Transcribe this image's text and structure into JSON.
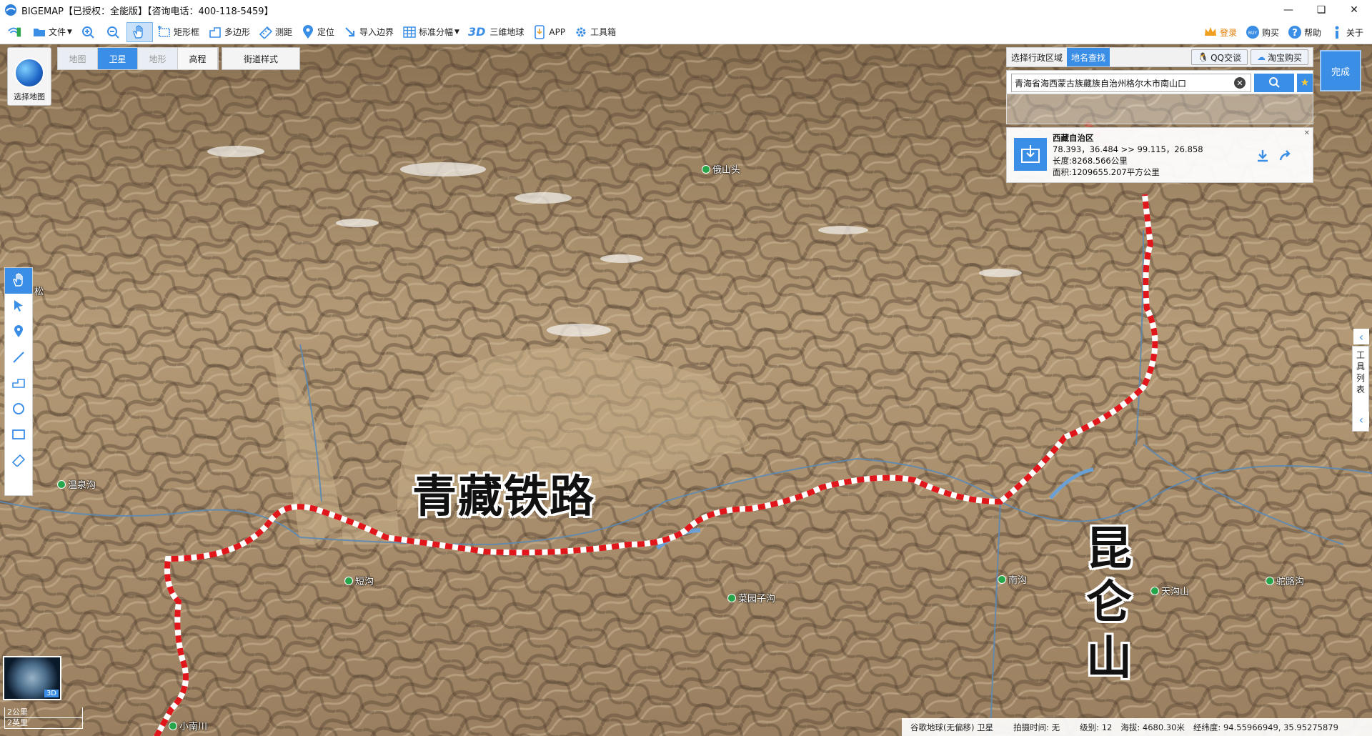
{
  "window": {
    "title": "BIGEMAP【已授权：全能版】【咨询电话：400-118-5459】",
    "minimize_icon": "minimize-icon",
    "maximize_icon": "restore-icon",
    "close_icon": "close-icon"
  },
  "toolbar": {
    "file": "文件",
    "rect": "矩形框",
    "polygon": "多边形",
    "measure": "测距",
    "locate": "定位",
    "import_boundary": "导入边界",
    "std_tiles": "标准分幅",
    "three_d_badge": "3D",
    "three_d_globe": "三维地球",
    "app": "APP",
    "toolbox": "工具箱",
    "login": "登录",
    "buy": "购买",
    "help": "帮助",
    "about": "关于"
  },
  "map_controls": {
    "select_map": "选择地图",
    "types": [
      "地图",
      "卫星",
      "地形",
      "高程"
    ],
    "active_type": "卫星",
    "street_style": "街道样式"
  },
  "panel": {
    "tab_region": "选择行政区域",
    "tab_search": "地名查找",
    "qq": "QQ交谈",
    "taobao": "淘宝购买",
    "search_value": "青海省海西蒙古族藏族自治州格尔木市南山口",
    "done": "完成",
    "result": {
      "name": "西藏自治区",
      "coords": "78.393，36.484 >> 99.115，26.858",
      "length": "长度:8268.566公里",
      "area": "面积:1209655.207平方公里"
    }
  },
  "toollist": [
    "工",
    "具",
    "列",
    "表"
  ],
  "map_labels": {
    "railway": "青藏铁路",
    "kunlun": [
      "昆",
      "仑",
      "山"
    ],
    "pois": [
      "俄山头",
      "温泉沟",
      "短沟",
      "菜园子沟",
      "南沟",
      "天沟山",
      "驼路沟",
      "小南川"
    ],
    "left_edge_text": "松"
  },
  "overview": {
    "badge": "3D"
  },
  "scale": {
    "km": "2公里",
    "mi": "2英里"
  },
  "status": {
    "source": "谷歌地球(无偏移) 卫星",
    "capture_time": "拍摄时间: 无",
    "level": "级别:  12",
    "altitude": "海拔: 4680.30米",
    "coords": "经纬度:  94.55966949, 35.95275879"
  },
  "colors": {
    "accent": "#3b8ee6",
    "railway_red": "#e0161b",
    "poi_green": "#27a54a"
  }
}
